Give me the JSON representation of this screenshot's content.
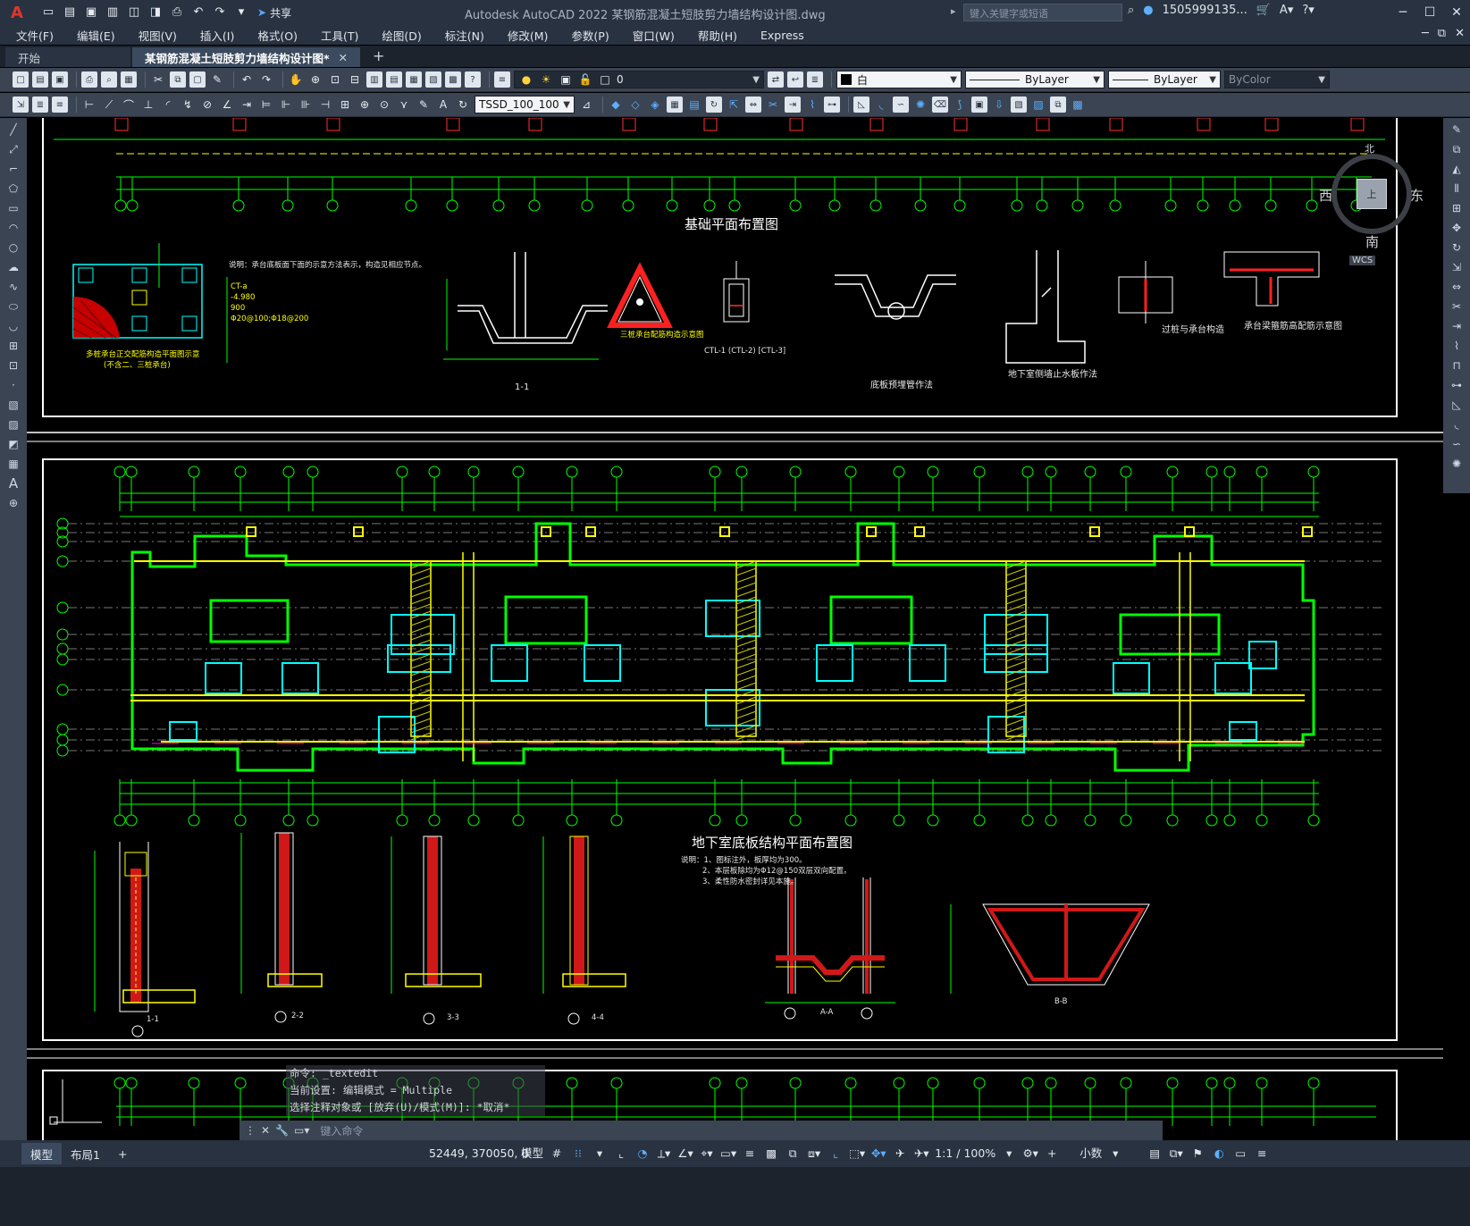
{
  "titlebar": {
    "app_logo": "A",
    "share_label": "共享",
    "title": "Autodesk AutoCAD 2022    某钢筋混凝土短肢剪力墙结构设计图.dwg",
    "search_placeholder": "键入关键字或短语",
    "user": "1505999135...",
    "cart_icon": "cart-icon"
  },
  "menu": {
    "items": [
      "文件(F)",
      "编辑(E)",
      "视图(V)",
      "插入(I)",
      "格式(O)",
      "工具(T)",
      "绘图(D)",
      "标注(N)",
      "修改(M)",
      "参数(P)",
      "窗口(W)",
      "帮助(H)",
      "Express"
    ]
  },
  "tabs": {
    "start": "开始",
    "active": "某钢筋混凝土短肢剪力墙结构设计图*",
    "add": "+"
  },
  "toolbar1": {
    "layer_value": "0",
    "color_value": "白",
    "linetype_value": "ByLayer",
    "lineweight_value": "ByLayer",
    "plotstyle_value": "ByColor"
  },
  "toolbar2": {
    "dimstyle_value": "TSSD_100_100"
  },
  "drawing": {
    "title_foundation": "基础平面布置图",
    "title_basement": "地下室底板结构平面布置图",
    "detail_labels": [
      "1-1",
      "2-2",
      "3-3",
      "4-4",
      "A-A",
      "B-B"
    ],
    "notes_top": "说明：承台底板面下面的示意方法表示，构造见相应节点。",
    "note_ct": "CT-a",
    "note_elev": "-4.980",
    "note_900": "900",
    "note_rebar": "Φ20@100;Φ18@200",
    "caption_pile": "多桩承台正交配筋构造平面图示意",
    "caption_pile2": "(不含二、三桩承台)",
    "caption_tri": "三桩承台配筋构造示意图",
    "caption_ctl": "CTL-1 (CTL-2) [CTL-3]",
    "caption_sump": "底板预埋管作法",
    "caption_wall": "地下室侧墙止水板作法",
    "caption_joint": "过桩与承台构造",
    "caption_cap": "承台梁箍筋高配筋示意图",
    "notes_basement": [
      "说明：1、图标注外，板厚均为300。",
      "2、本层板除均为Φ12@150双层双向配置。",
      "3、柔性防水密封详见本施。"
    ],
    "compass": {
      "north": "北",
      "south": "南",
      "east": "东",
      "west": "西",
      "top": "上",
      "wcs": "WCS"
    }
  },
  "command": {
    "history": [
      "命令: _textedit",
      "当前设置: 编辑模式 = Multiple",
      "选择注释对象或 [放弃(U)/模式(M)]: *取消*"
    ],
    "input_placeholder": "键入命令"
  },
  "status": {
    "tab_model": "模型",
    "tab_layout": "布局1",
    "tab_add": "+",
    "coords": "52449, 370050, 0",
    "mode": "模型",
    "scale": "1:1 / 100%",
    "units": "小数"
  }
}
